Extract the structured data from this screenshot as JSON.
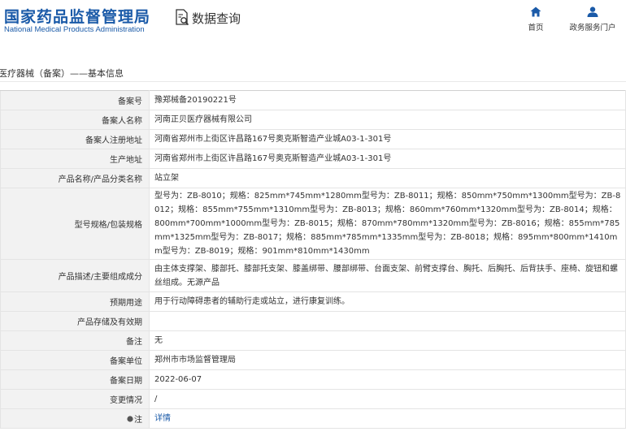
{
  "header": {
    "logo_cn": "国家药品监督管理局",
    "logo_en": "National Medical Products Administration",
    "query_label": "数据查询",
    "nav": {
      "home_label": "首页",
      "service_label": "政务服务门户"
    }
  },
  "page_title": "医疗器械（备案）——基本信息",
  "rows": [
    {
      "label": "备案号",
      "value": "豫郑械备20190221号"
    },
    {
      "label": "备案人名称",
      "value": "河南正贝医疗器械有限公司"
    },
    {
      "label": "备案人注册地址",
      "value": "河南省郑州市上街区许昌路167号奥克斯智造产业城A03-1-301号"
    },
    {
      "label": "生产地址",
      "value": "河南省郑州市上街区许昌路167号奥克斯智造产业城A03-1-301号"
    },
    {
      "label": "产品名称/产品分类名称",
      "value": "站立架"
    },
    {
      "label": "型号规格/包装规格",
      "value": "型号为：ZB-8010；规格：825mm*745mm*1280mm型号为：ZB-8011；规格：850mm*750mm*1300mm型号为：ZB-8012；规格：855mm*755mm*1310mm型号为：ZB-8013；规格：860mm*760mm*1320mm型号为：ZB-8014；规格：800mm*700mm*1000mm型号为：ZB-8015；规格：870mm*780mm*1320mm型号为：ZB-8016；规格：855mm*785mm*1325mm型号为：ZB-8017；规格：885mm*785mm*1335mm型号为：ZB-8018；规格：895mm*800mm*1410mm型号为：ZB-8019；规格：901mm*810mm*1430mm"
    },
    {
      "label": "产品描述/主要组成成分",
      "value": "由主体支撑架、膝部托、膝部托支架、膝盖绑带、腰部绑带、台面支架、前臂支撑台、胸托、后胸托、后背扶手、座椅、旋钮和螺丝组成。无源产品"
    },
    {
      "label": "预期用途",
      "value": "用于行动障碍患者的辅助行走或站立，进行康复训练。"
    },
    {
      "label": "产品存储及有效期",
      "value": ""
    },
    {
      "label": "备注",
      "value": "无"
    },
    {
      "label": "备案单位",
      "value": "郑州市市场监督管理局"
    },
    {
      "label": "备案日期",
      "value": "2022-06-07"
    },
    {
      "label": "变更情况",
      "value": "/"
    }
  ],
  "note_row": {
    "label": "注",
    "link_text": "详情"
  }
}
